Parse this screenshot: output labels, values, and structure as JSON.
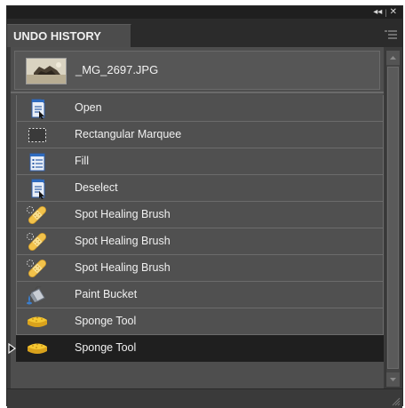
{
  "panel": {
    "title": "UNDO HISTORY",
    "controls": {
      "collapse": "◂◂",
      "separator": "|",
      "close": "✕"
    }
  },
  "snapshot": {
    "label": "_MG_2697.JPG"
  },
  "history": [
    {
      "label": "Open",
      "icon": "document-icon"
    },
    {
      "label": "Rectangular Marquee",
      "icon": "marquee-icon"
    },
    {
      "label": "Fill",
      "icon": "list-document-icon"
    },
    {
      "label": "Deselect",
      "icon": "document-icon"
    },
    {
      "label": "Spot Healing Brush",
      "icon": "bandage-icon"
    },
    {
      "label": "Spot Healing Brush",
      "icon": "bandage-icon"
    },
    {
      "label": "Spot Healing Brush",
      "icon": "bandage-icon"
    },
    {
      "label": "Paint Bucket",
      "icon": "paint-bucket-icon"
    },
    {
      "label": "Sponge Tool",
      "icon": "sponge-icon"
    },
    {
      "label": "Sponge Tool",
      "icon": "sponge-icon",
      "selected": true
    }
  ],
  "colors": {
    "panel_bg": "#3b3b3b",
    "row_bg": "#505050",
    "selected_row_bg": "#1f1f1f",
    "text": "#f0f0f0"
  }
}
